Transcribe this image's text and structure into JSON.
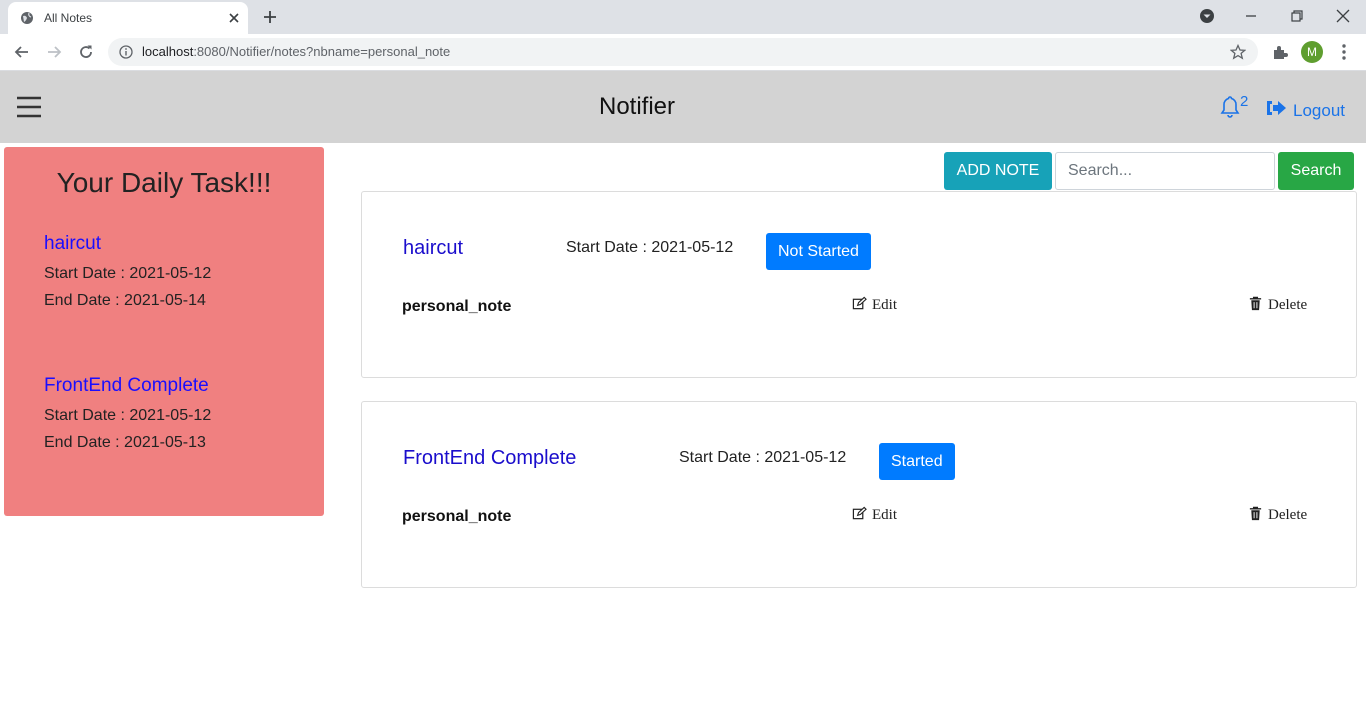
{
  "browser": {
    "tab_title": "All Notes",
    "url_host": "localhost",
    "url_rest": ":8080/Notifier/notes?nbname=personal_note",
    "avatar_letter": "M"
  },
  "navbar": {
    "brand": "Notifier",
    "notification_count": "2",
    "logout_label": "Logout"
  },
  "sidebar": {
    "title": "Your Daily Task!!!",
    "tasks": [
      {
        "name": "haircut",
        "start": "Start Date : 2021-05-12",
        "end": "End Date : 2021-05-14"
      },
      {
        "name": "FrontEnd Complete",
        "start": "Start Date : 2021-05-12",
        "end": "End Date : 2021-05-13"
      }
    ]
  },
  "toolbar": {
    "add_note_label": "ADD NOTE",
    "search_placeholder": "Search...",
    "search_label": "Search"
  },
  "notes": [
    {
      "title": "haircut",
      "start": "Start Date : 2021-05-12",
      "status": "Not Started",
      "notebook": "personal_note",
      "edit_label": "Edit",
      "delete_label": "Delete"
    },
    {
      "title": "FrontEnd Complete",
      "start": "Start Date : 2021-05-12",
      "status": "Started",
      "notebook": "personal_note",
      "edit_label": "Edit",
      "delete_label": "Delete"
    }
  ],
  "colors": {
    "navbar_bg": "#d3d3d3",
    "sidebar_bg": "#f08080",
    "add_note": "#17a2b8",
    "search": "#28a745",
    "status": "#007bff",
    "link_blue": "#1a73e8"
  }
}
